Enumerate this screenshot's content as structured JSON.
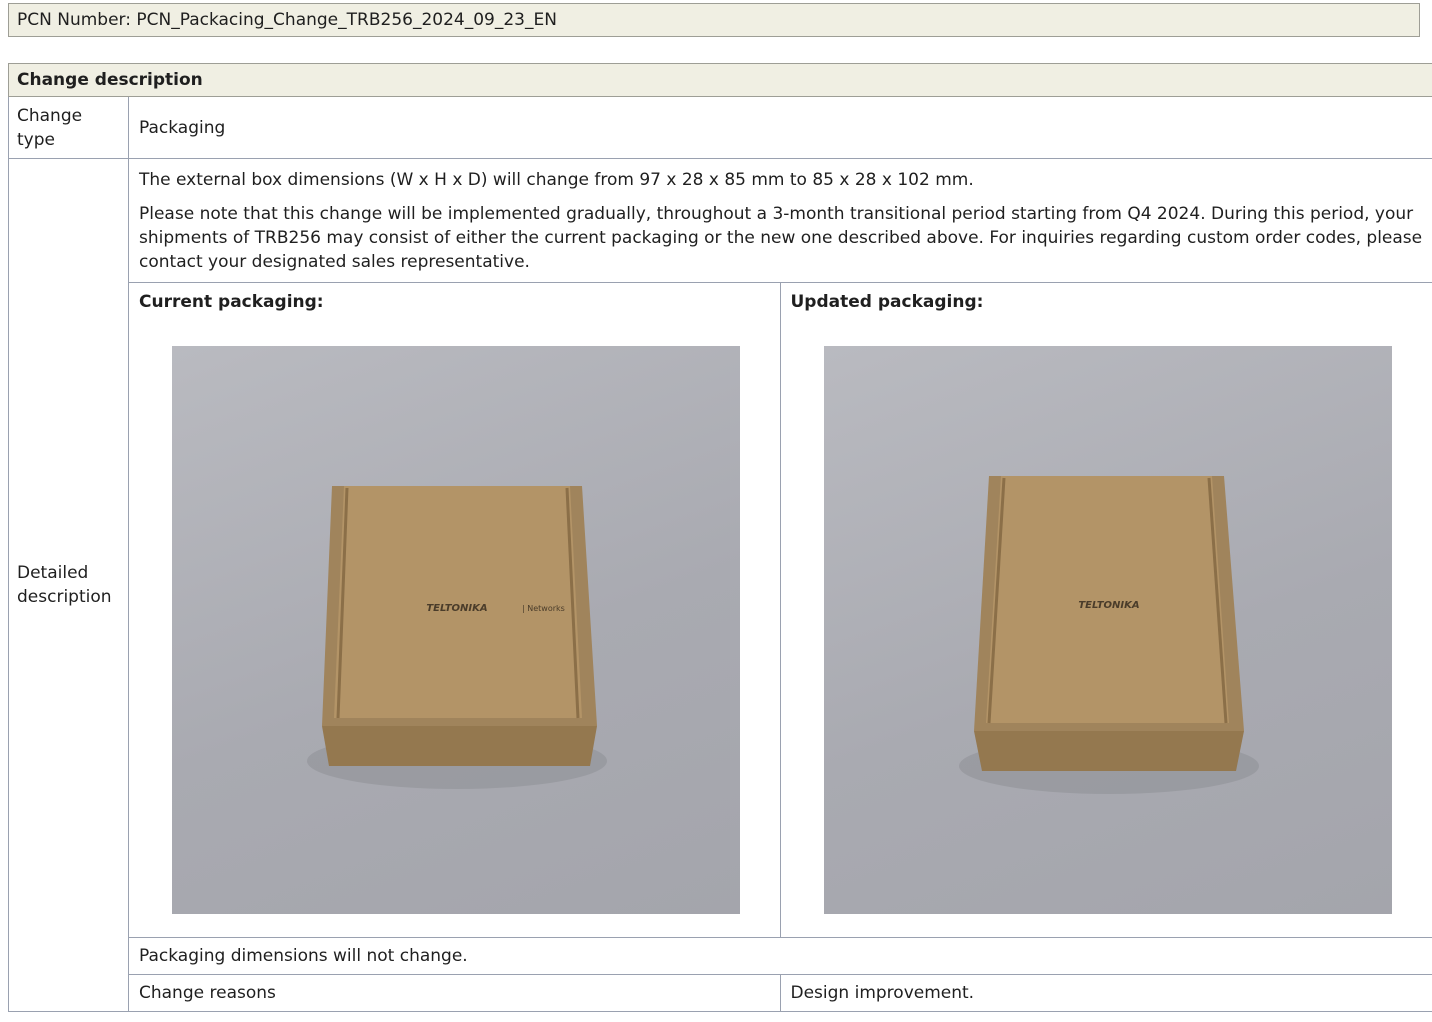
{
  "pcn": {
    "label": "PCN Number: PCN_Packacing_Change_TRB256_2024_09_23_EN"
  },
  "section": {
    "title": "Change description"
  },
  "change_type": {
    "label": "Change type",
    "value": "Packaging"
  },
  "detailed": {
    "label": "Detailed description",
    "paragraph1": "The external box dimensions (W x H x D) will change from 97 x 28 x 85 mm to 85 x 28 x 102 mm.",
    "paragraph2": "Please note that this change will be implemented gradually, throughout a 3-month transitional period starting from Q4 2024. During this period, your shipments of TRB256 may consist of either the current packaging or the new one described above. For inquiries regarding custom order codes, please contact your designated sales representative.",
    "current": {
      "title": "Current packaging:",
      "logo_text": "TELTONIKA",
      "logo_suffix": "| Networks"
    },
    "updated": {
      "title": "Updated packaging:",
      "logo_text": "TELTONIKA"
    },
    "dimensions_note": "Packaging dimensions will not change.",
    "reasons_label": "Change reasons",
    "reasons_value": "Design improvement."
  }
}
